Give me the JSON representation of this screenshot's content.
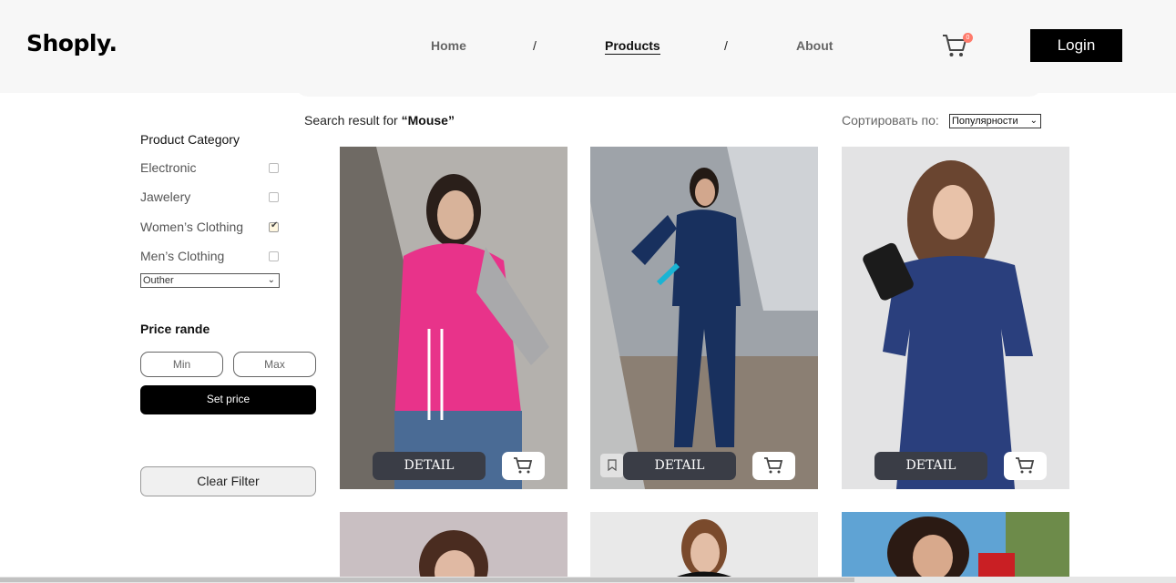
{
  "header": {
    "logo": "Shoply.",
    "nav": [
      {
        "label": "Home",
        "active": false
      },
      {
        "label": "Products",
        "active": true
      },
      {
        "label": "About",
        "active": false
      }
    ],
    "nav_separator": "/",
    "cart_count": "0",
    "login_label": "Login"
  },
  "sidebar": {
    "category_title": "Product Category",
    "categories": [
      {
        "label": "Electronic",
        "checked": false
      },
      {
        "label": "Jawelery",
        "checked": false
      },
      {
        "label": "Women’s Clothing",
        "checked": true
      },
      {
        "label": "Men’s Clothing",
        "checked": false
      }
    ],
    "category_select_value": "Outher",
    "price_title": "Price rande",
    "min_placeholder": "Min",
    "max_placeholder": "Max",
    "set_price_label": "Set price",
    "clear_filter_label": "Clear Filter"
  },
  "results": {
    "search_prefix": "Search result for ",
    "search_query": "“Mouse”",
    "sort_label": "Сортировать по:",
    "sort_value": "Популярности"
  },
  "product_card": {
    "detail_label": "DETAIL"
  },
  "colors": {
    "header_bg": "#f7f7f7",
    "detail_button": "#3a3d46",
    "cart_badge": "#ff7a6b"
  }
}
